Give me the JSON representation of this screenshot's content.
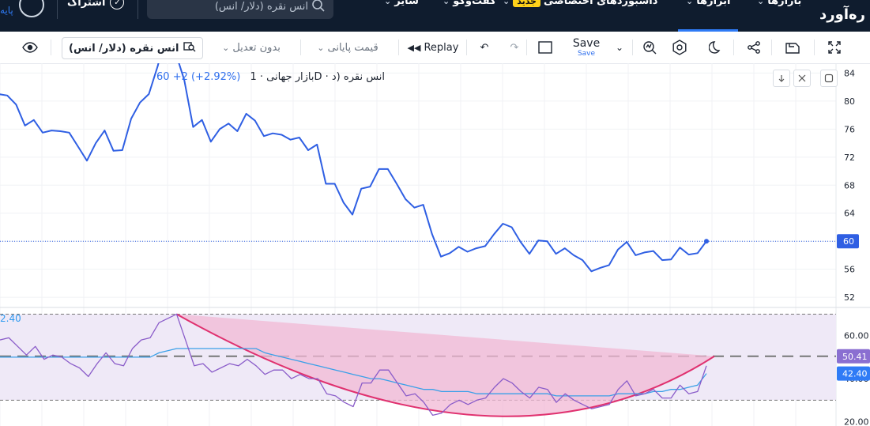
{
  "nav": {
    "brand": "ره‌آورد",
    "items": [
      {
        "label": "بازارها",
        "badge": ""
      },
      {
        "label": "ابزارها",
        "badge": ""
      },
      {
        "label": "داشبوردهای اختصاصی",
        "badge": "جدید"
      },
      {
        "label": "گفت‌وگو",
        "badge": ""
      },
      {
        "label": "سایر",
        "badge": ""
      }
    ],
    "search_placeholder": "انس نقره (دلار/ انس)",
    "subscription_label": "اشتراک",
    "edge_text": "پایه"
  },
  "toolbar": {
    "symbol": "انس نقره (دلار/ انس)",
    "adjustment": "بدون تعدیل",
    "price_type": "قیمت پایانی",
    "replay": "Replay",
    "save": "Save",
    "save_sub": "Save"
  },
  "legend": {
    "title": "بازار جهانی · 1D · انس نقره (د",
    "last": "60",
    "change": "+2 (+2.92%)"
  },
  "rsi_left_value": "2.40",
  "colors": {
    "price_line": "#2f5fe3",
    "rsi_line": "#8a5cc9",
    "rsi_ma": "#3aa0e8",
    "curve": "#e0316f",
    "fill": "#f2b8d4",
    "rsi_band": "#efe9f7"
  },
  "chart_data": [
    {
      "type": "line",
      "name": "price",
      "y_ticks": [
        84,
        80,
        76,
        72,
        68,
        64,
        60,
        56,
        52
      ],
      "ylim": [
        51,
        84.5
      ],
      "last_label": "60",
      "values": [
        81,
        80.8,
        79.5,
        76.5,
        77.3,
        75.5,
        75.8,
        75.7,
        75.5,
        73.5,
        71.5,
        74,
        75.8,
        72.9,
        73,
        77.5,
        79.8,
        81,
        85,
        90,
        87,
        83,
        76.3,
        77.3,
        74.2,
        76,
        76.8,
        75.7,
        78.2,
        77.2,
        75,
        75.4,
        75.2,
        74.5,
        74.8,
        73,
        73.8,
        68.2,
        68.2,
        65.5,
        63.8,
        67.5,
        67.8,
        70.3,
        70.3,
        68.2,
        66,
        64.8,
        65.2,
        61,
        57.8,
        58.3,
        59.2,
        58.5,
        59,
        59.3,
        61,
        62.5,
        62,
        59.9,
        58.2,
        60.1,
        60,
        58.2,
        59,
        58,
        57.3,
        55.7,
        56.2,
        56.6,
        58.8,
        59.9,
        58,
        58.4,
        58.6,
        57.3,
        57.4,
        59.1,
        58.1,
        58.3,
        60
      ]
    },
    {
      "type": "line",
      "name": "RSI",
      "y_ticks": [
        60.0,
        40.0,
        20.0
      ],
      "ylim": [
        18,
        72
      ],
      "band": [
        70,
        30
      ],
      "mid_level": 50.41,
      "last_rsi": "50.41",
      "last_ma": "42.40",
      "rsi": [
        58,
        59,
        55,
        51,
        55,
        49,
        51,
        50,
        47,
        45,
        41,
        47,
        52,
        47,
        46,
        54,
        58,
        59,
        66,
        68,
        70,
        58,
        46,
        47,
        43,
        45,
        47,
        46,
        49,
        46,
        42,
        44,
        44,
        40,
        42,
        40,
        40,
        33,
        32,
        29,
        27,
        38,
        38,
        44,
        44,
        38,
        32,
        33,
        29,
        23,
        24,
        28,
        30,
        28,
        30,
        31,
        36,
        40,
        38,
        34,
        31,
        36,
        35,
        29,
        33,
        30,
        28,
        26,
        27,
        28,
        35,
        39,
        32,
        33,
        35,
        31,
        31,
        37,
        33,
        34,
        46
      ],
      "ma": [
        50,
        50,
        50,
        50,
        50,
        50,
        50,
        50,
        50,
        50,
        50,
        50,
        50,
        50,
        50,
        50,
        50,
        50,
        52,
        53,
        54,
        54,
        54,
        54,
        54,
        54,
        54,
        54,
        54,
        54,
        52,
        51,
        50,
        49,
        48,
        47,
        46,
        45,
        44,
        43,
        42,
        41,
        40,
        40,
        39,
        38,
        37,
        36,
        35,
        35,
        34,
        34,
        34,
        34,
        33,
        33,
        33,
        33,
        33,
        33,
        33,
        33,
        33,
        32,
        32,
        32,
        32,
        32,
        32,
        32,
        33,
        33,
        33,
        33,
        34,
        34,
        35,
        35,
        36,
        37,
        42.4
      ]
    }
  ]
}
